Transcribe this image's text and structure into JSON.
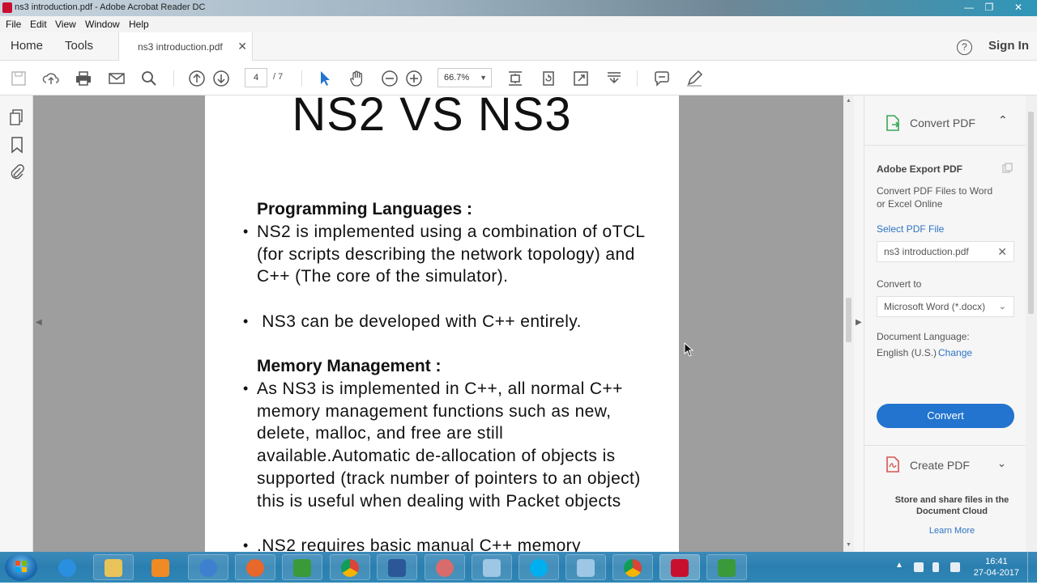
{
  "window": {
    "title": "ns3 introduction.pdf - Adobe Acrobat Reader DC",
    "minimize": "—",
    "maximize": "❐",
    "close": "✕"
  },
  "menu": [
    "File",
    "Edit",
    "View",
    "Window",
    "Help"
  ],
  "nav": {
    "home": "Home",
    "tools": "Tools",
    "doc_tab": "ns3 introduction.pdf",
    "tab_close": "✕",
    "help": "?",
    "sign_in": "Sign In"
  },
  "toolbar": {
    "page_current": "4",
    "page_total": "/ 7",
    "zoom": "66.7%",
    "zoom_caret": "▼"
  },
  "document": {
    "heading": "NS2 VS NS3",
    "sections": [
      {
        "title": "Programming Languages :",
        "bullets": [
          "NS2 is implemented using a combination of oTCL (for scripts describing the network topology) and C++ (The core of the simulator).",
          " NS3 can be developed with C++ entirely."
        ]
      },
      {
        "title": "Memory Management :",
        "bullets": [
          "As NS3 is implemented in C++, all normal C++ memory management functions such as new, delete, malloc, and free are still available.Automatic de-allocation of objects is supported  (track number of pointers to an object) this is useful when dealing with Packet objects",
          ".NS2 requires basic manual C++ memory"
        ]
      }
    ],
    "bullet_char": "•"
  },
  "right_panel": {
    "convert_pdf": "Convert PDF",
    "export_title": "Adobe Export PDF",
    "export_desc_1": "Convert PDF Files to Word",
    "export_desc_2": "or Excel Online",
    "select_file": "Select PDF File",
    "selected_file": "ns3 introduction.pdf",
    "convert_to_label": "Convert to",
    "convert_to_value": "Microsoft Word (*.docx)",
    "doc_lang_label": "Document Language:",
    "doc_lang_value": "English (U.S.)",
    "change": "Change",
    "convert_button": "Convert",
    "create_pdf": "Create PDF",
    "store_share_1": "Store and share files in the",
    "store_share_2": "Document Cloud",
    "learn_more": "Learn More"
  },
  "taskbar": {
    "time": "16:41",
    "date": "27-04-2017"
  },
  "colors": {
    "accent_blue": "#2274ce",
    "link_blue": "#2d73c4",
    "convert_green": "#3aa757",
    "create_red": "#d9534f",
    "acrobat_red": "#c8102e"
  }
}
